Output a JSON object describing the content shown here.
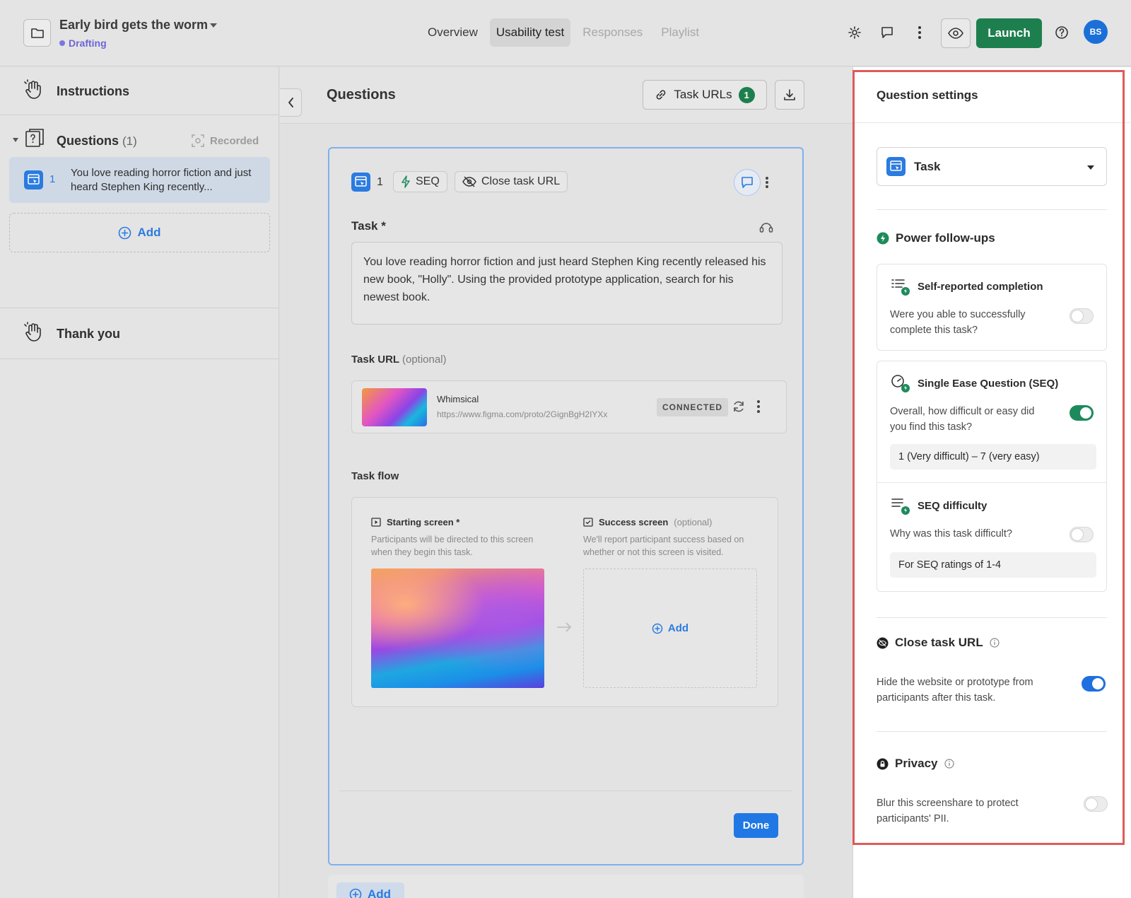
{
  "project": {
    "title": "Early bird gets the worm",
    "status": "Drafting"
  },
  "nav": {
    "tabs": [
      {
        "label": "Overview"
      },
      {
        "label": "Usability test"
      },
      {
        "label": "Responses"
      },
      {
        "label": "Playlist"
      }
    ],
    "launch_label": "Launch",
    "avatar_initials": "BS"
  },
  "sidebar": {
    "instructions_label": "Instructions",
    "questions_label": "Questions",
    "questions_count": "(1)",
    "recorded_label": "Recorded",
    "question_item": {
      "number": "1",
      "text": "You love reading horror fiction and just heard Stephen King recently..."
    },
    "add_label": "Add",
    "thankyou_label": "Thank you"
  },
  "main": {
    "title": "Questions",
    "task_urls_label": "Task URLs",
    "task_urls_count": "1",
    "card": {
      "number": "1",
      "seq_chip": "SEQ",
      "close_chip": "Close task URL",
      "task_label": "Task *",
      "task_text": "You love reading horror fiction and just heard Stephen King recently released his new book, \"Holly\". Using the provided prototype application, search for his newest book.",
      "task_url_label": "Task URL",
      "task_url_optional": "(optional)",
      "url_name": "Whimsical",
      "url_value": "https://www.figma.com/proto/2GignBgH2IYXx",
      "connected_label": "CONNECTED",
      "task_flow_label": "Task flow",
      "starting_title": "Starting screen *",
      "starting_desc": "Participants will be directed to this screen when they begin this task.",
      "success_title": "Success screen",
      "success_optional": "(optional)",
      "success_desc": "We'll report participant success based on whether or not this screen is visited.",
      "success_add": "Add",
      "done_label": "Done"
    },
    "bottom_add_label": "Add"
  },
  "settings": {
    "title": "Question settings",
    "type_value": "Task",
    "power_followups_label": "Power follow-ups",
    "followups": [
      {
        "title": "Self-reported completion",
        "desc": "Were you able to successfully complete this task?",
        "enabled": false
      },
      {
        "title": "Single Ease Question (SEQ)",
        "desc": "Overall, how difficult or easy did you find this task?",
        "enabled": true,
        "pill": "1 (Very difficult) – 7 (very easy)"
      },
      {
        "title": "SEQ difficulty",
        "desc": "Why was this task difficult?",
        "enabled": false,
        "pill": "For SEQ ratings of 1-4"
      }
    ],
    "close_task_url": {
      "label": "Close task URL",
      "desc": "Hide the website or prototype from participants after this task.",
      "enabled": true
    },
    "privacy": {
      "label": "Privacy",
      "desc": "Blur this screenshare to protect participants' PII.",
      "enabled": false
    }
  },
  "colors": {
    "accent_blue": "#2b7be0",
    "launch_green": "#1d7f4e",
    "drafting_purple": "#6b66d6",
    "highlight_red": "#e05a5a"
  }
}
